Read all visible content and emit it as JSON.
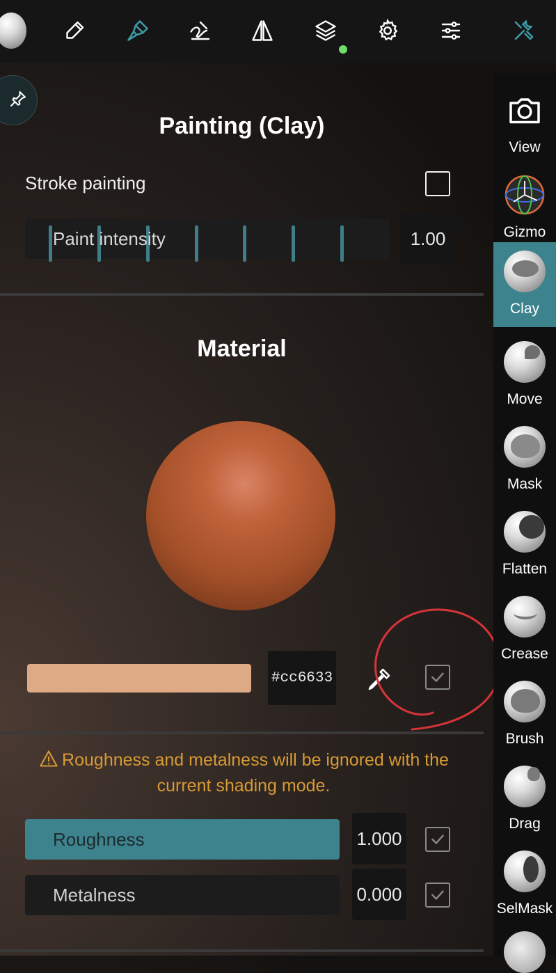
{
  "topbar": {
    "icons": [
      "sphere-icon",
      "pen-icon",
      "brush-icon",
      "stroke-icon",
      "symmetry-icon",
      "layers-icon",
      "gear-icon",
      "sliders-icon",
      "tools-icon"
    ]
  },
  "painting": {
    "title": "Painting (Clay)",
    "stroke_label": "Stroke painting",
    "stroke_checked": false,
    "intensity_label": "Paint intensity",
    "intensity_value": "1.00"
  },
  "material": {
    "title": "Material",
    "color_hex": "#cc6633",
    "swatch_color": "#ddaa85",
    "color_checked": true
  },
  "warning": {
    "text": "Roughness and metalness will be ignored with the current shading mode."
  },
  "roughness": {
    "label": "Roughness",
    "value": "1.000",
    "checked": true,
    "level": 1.0
  },
  "metalness": {
    "label": "Metalness",
    "value": "0.000",
    "checked": true,
    "level": 0.0
  },
  "sidebar": {
    "tools": [
      {
        "label": "View",
        "icon": "camera-icon",
        "selected": false
      },
      {
        "label": "Gizmo",
        "icon": "gizmo-icon",
        "selected": false
      },
      {
        "label": "Clay",
        "icon": "clay-icon",
        "selected": true
      },
      {
        "label": "Move",
        "icon": "move-icon",
        "selected": false
      },
      {
        "label": "Mask",
        "icon": "mask-icon",
        "selected": false
      },
      {
        "label": "Flatten",
        "icon": "flatten-icon",
        "selected": false
      },
      {
        "label": "Crease",
        "icon": "crease-icon",
        "selected": false
      },
      {
        "label": "Brush",
        "icon": "brush-tool-icon",
        "selected": false
      },
      {
        "label": "Drag",
        "icon": "drag-icon",
        "selected": false
      },
      {
        "label": "SelMask",
        "icon": "selmask-icon",
        "selected": false
      }
    ]
  },
  "colors": {
    "accent": "#3d838e",
    "warning": "#d79a34",
    "selected_tool": "#3d838e"
  }
}
